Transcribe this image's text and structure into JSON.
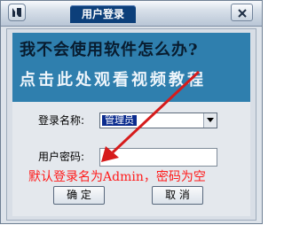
{
  "window": {
    "title": "用户登录"
  },
  "banner": {
    "line1": "我不会使用软件怎么办?",
    "line2": "点击此处观看视频教程"
  },
  "form": {
    "username_label": "登录名称:",
    "username_value": "管理员",
    "password_label": "用户密码:",
    "password_value": ""
  },
  "hint": "默认登录名为Admin，密码为空",
  "buttons": {
    "ok": "确 定",
    "cancel": "取 消"
  },
  "colors": {
    "title_tab": "#0c3f7a",
    "banner": "#2f7fae",
    "hint": "#ff1a1a",
    "arrow": "#d61b1b"
  },
  "icons": {
    "logo": "app-logo-icon",
    "close": "close-icon",
    "dropdown": "chevron-down-icon",
    "annotation": "red-arrow-icon"
  }
}
